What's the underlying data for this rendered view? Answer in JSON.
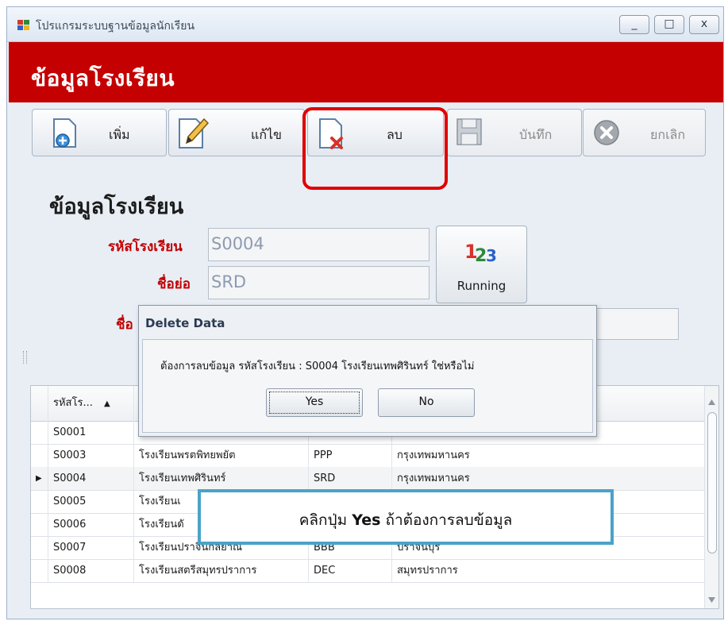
{
  "window": {
    "title": "โปรแกรมระบบฐานข้อมูลนักเรียน",
    "minimize": "_",
    "maximize": "□",
    "close": "x"
  },
  "banner": {
    "title": "ข้อมูลโรงเรียน",
    "color": "#c40000"
  },
  "toolbar": {
    "add": "เพิ่ม",
    "edit": "แก้ไข",
    "delete": "ลบ",
    "save": "บันทึก",
    "cancel": "ยกเลิก"
  },
  "form": {
    "heading": "ข้อมูลโรงเรียน",
    "school_id_label": "รหัสโรงเรียน",
    "school_id_value": "S0004",
    "short_name_label": "ชื่อย่อ",
    "short_name_value": "SRD",
    "name_label_partial": "ชื่อ",
    "running_label": "Running",
    "running_icon_text": "123"
  },
  "dialog": {
    "title": "Delete Data",
    "message": "ต้องการลบข้อมูล รหัสโรงเรียน :  S0004 โรงเรียนเทพศิรินทร์ ใช่หรือไม่",
    "yes": "Yes",
    "no": "No"
  },
  "grid": {
    "header_first": "รหัสโร...",
    "sort_indicator": "▲",
    "rows": [
      {
        "id": "S0001",
        "name": "",
        "short": "",
        "province": "",
        "current": false
      },
      {
        "id": "S0003",
        "name": "โรงเรียนพรตพิทยพยัต",
        "short": "PPP",
        "province": "กรุงเทพมหานคร",
        "current": false
      },
      {
        "id": "S0004",
        "name": "โรงเรียนเทพศิรินทร์",
        "short": "SRD",
        "province": "กรุงเทพมหานคร",
        "current": true
      },
      {
        "id": "S0005",
        "name": "โรงเรียนเ",
        "short": "",
        "province": "",
        "current": false
      },
      {
        "id": "S0006",
        "name": "โรงเรียนดั",
        "short": "",
        "province": "",
        "current": false
      },
      {
        "id": "S0007",
        "name": "โรงเรียนปราจีนกัลยาณี",
        "short": "BBB",
        "province": "ปราจีนบุรี",
        "current": false
      },
      {
        "id": "S0008",
        "name": "โรงเรียนสตรีสมุทรปราการ",
        "short": "DEC",
        "province": "สมุทรปราการ",
        "current": false
      }
    ],
    "row_pointer": "▶"
  },
  "callout": {
    "prefix": "คลิกปุ่ม ",
    "bold": "Yes",
    "suffix": " ถ้าต้องการลบข้อมูล"
  },
  "colors": {
    "highlight": "#e10000",
    "callout_border": "#4aa3c8",
    "label": "#c00000"
  }
}
